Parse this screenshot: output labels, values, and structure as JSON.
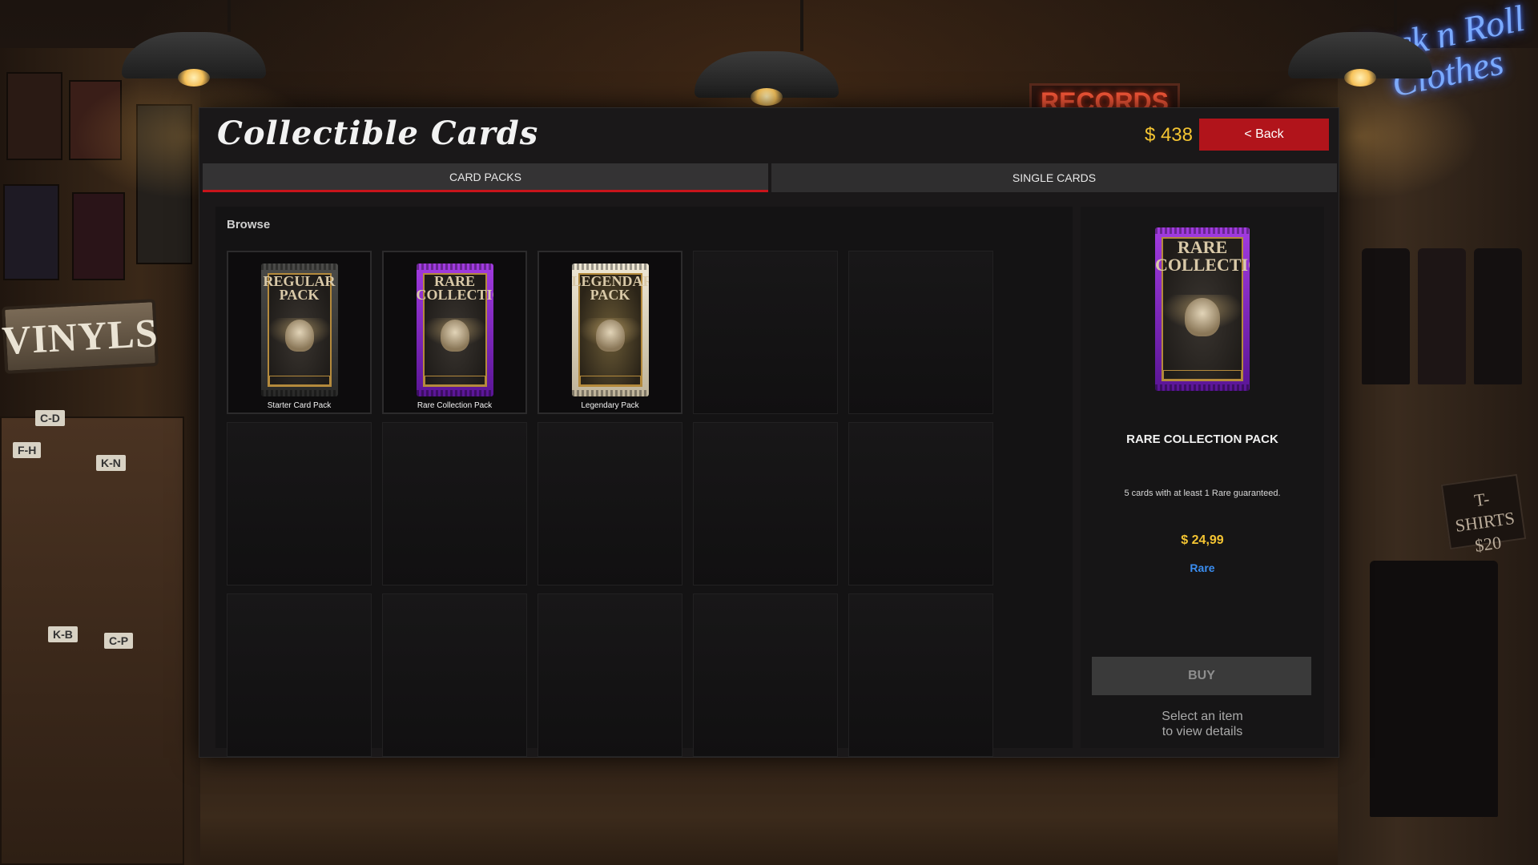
{
  "header": {
    "title": "Collectible Cards",
    "money": "$ 438",
    "back_label": "< Back"
  },
  "tabs": [
    {
      "label": "CARD PACKS",
      "active": true
    },
    {
      "label": "SINGLE CARDS",
      "active": false
    }
  ],
  "browse": {
    "label": "Browse",
    "items": [
      {
        "name": "Starter Card Pack",
        "pack_text": "REGULAR PACK",
        "style": "regular"
      },
      {
        "name": "Rare Collection Pack",
        "pack_text": "RARE COLLECTION",
        "style": "rare"
      },
      {
        "name": "Legendary Pack",
        "pack_text": "LEGENDARY PACK",
        "style": "legend"
      }
    ]
  },
  "detail": {
    "pack_text": "RARE COLLECTION",
    "name": "RARE COLLECTION PACK",
    "description": "5 cards with at least 1 Rare guaranteed.",
    "price": "$ 24,99",
    "rarity": "Rare",
    "buy_label": "BUY",
    "hint_line1": "Select an item",
    "hint_line2": "to view details"
  },
  "background": {
    "vinyls_sign": "VINYLS",
    "records_sign": "RECORDS",
    "neon_line1": "Rock n Roll",
    "neon_line2": "Clothes",
    "tshirt_line1": "T-SHIRTS",
    "tshirt_line2": "$20"
  },
  "colors": {
    "accent_red": "#b1141b",
    "money_gold": "#f4c432",
    "rarity_blue": "#3a8df0"
  }
}
